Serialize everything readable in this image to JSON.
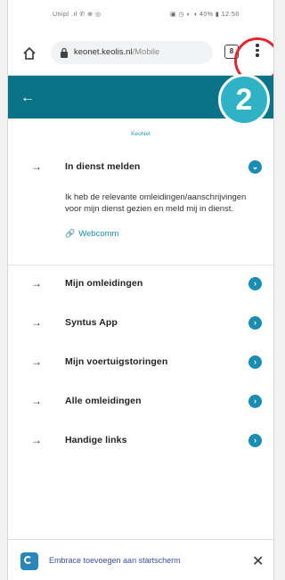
{
  "status_bar": {
    "left": "Unipl .ıl ✆ ⊕ ◎",
    "right": "▣ ◷ ◐ ◑ 40% ▮ 12:50"
  },
  "browser": {
    "url_host": "keonet.keolis.nl",
    "url_path": "/Mobile",
    "tab_count": "8",
    "icons": [
      "home-icon",
      "lock-icon",
      "tabs-icon",
      "menu-icon"
    ]
  },
  "header": {
    "back_icon": "back-arrow-icon",
    "step_number": "2",
    "accent_color": "#0b7388"
  },
  "brand_text": "KeoNet",
  "menu": {
    "items": [
      {
        "label": "In dienst melden",
        "expanded": true
      },
      {
        "label": "Mijn omleidingen"
      },
      {
        "label": "Syntus App"
      },
      {
        "label": "Mijn voertuigstoringen"
      },
      {
        "label": "Alle omleidingen"
      },
      {
        "label": "Handige links"
      }
    ],
    "expanded_text": "Ik heb de relevante omleidingen/aanschrijvingen voor mijn dienst gezien en meld mij in dienst.",
    "webcomm_label": "Webcomm"
  },
  "banner": {
    "text": "Embrace toevoegen aan startscherm",
    "close_label": "✕"
  }
}
